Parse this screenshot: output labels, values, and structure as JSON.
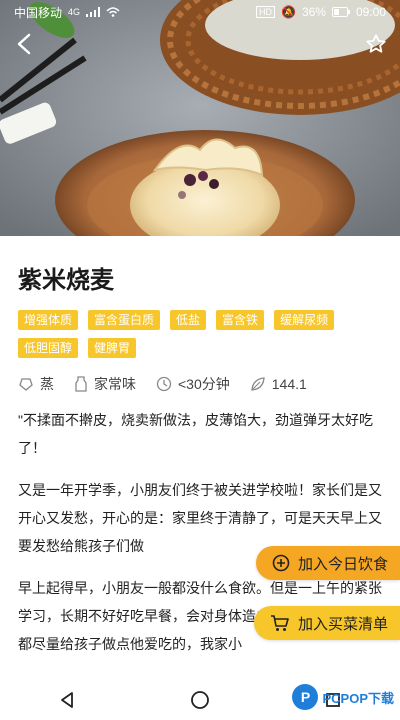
{
  "status_bar": {
    "carrier": "中国移动",
    "signal": "4G",
    "battery": "36%",
    "time": "09:00"
  },
  "header": {
    "back_icon": "back-chevron-icon",
    "favorite_icon": "star-outline-icon"
  },
  "recipe": {
    "title": "紫米烧麦",
    "tags": [
      "增强体质",
      "富含蛋白质",
      "低盐",
      "富含铁",
      "缓解尿频",
      "低胆固醇",
      "健脾胃"
    ],
    "meta": {
      "method": "蒸",
      "taste": "家常味",
      "time": "<30分钟",
      "popularity": "144.1"
    },
    "paragraphs": [
      "\"不揉面不擀皮，烧卖新做法，皮薄馅大，劲道弹牙太好吃了！",
      "又是一年开学季，小朋友们终于被关进学校啦！家长们是又开心又发愁，开心的是：家里终于清静了，可是天天早上又要发愁给熊孩子们做",
      "早上起得早，小朋友一般都没什么食欲。但是一上午的紧张学习，长期不好好吃早餐，会对身体造成影响，于是我每天都尽量给孩子做点他爱吃的，我家小"
    ]
  },
  "actions": {
    "add_today": "加入今日饮食",
    "add_shopping_list": "加入买菜清单"
  },
  "watermark": {
    "text": "PCPOP下载"
  },
  "colors": {
    "tag_bg": "#f7c62b",
    "today_btn": "#f5a623",
    "list_btn": "#f7c62b"
  }
}
